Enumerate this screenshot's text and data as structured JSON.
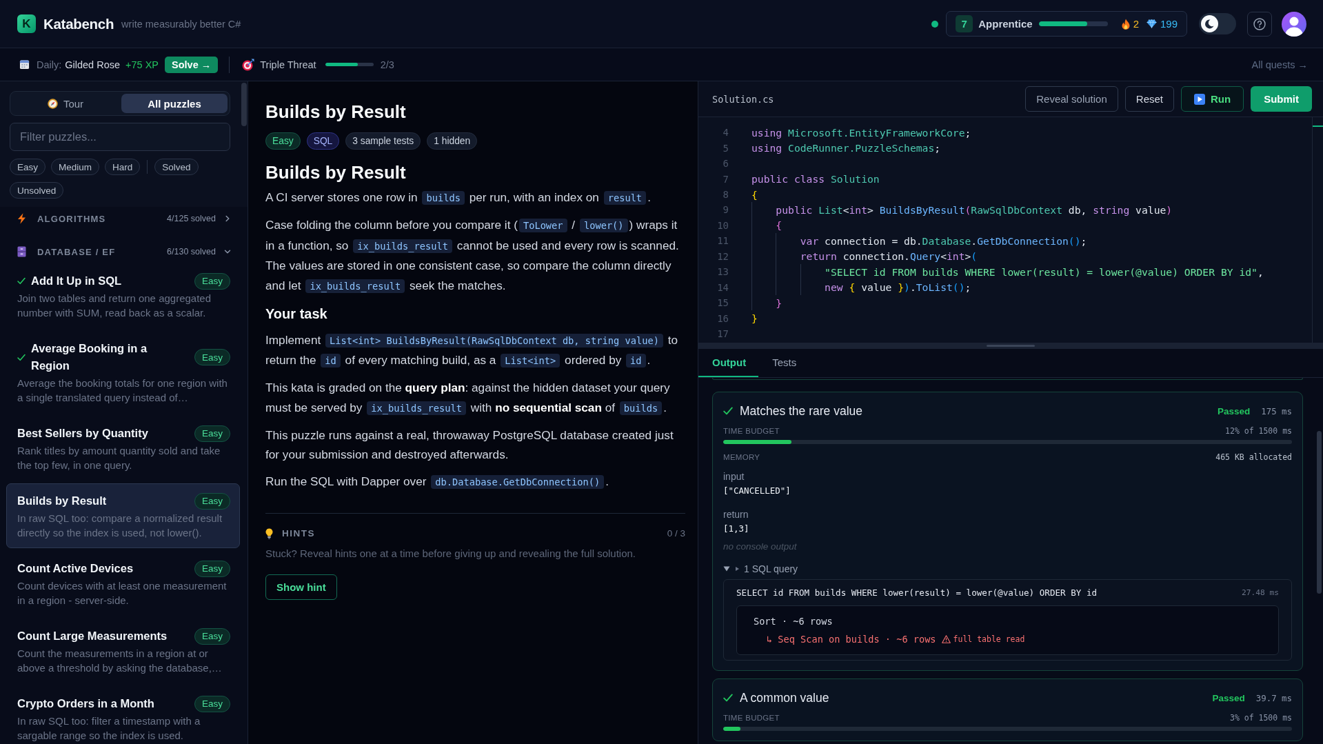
{
  "header": {
    "logo_letter": "K",
    "name": "Katabench",
    "tagline": "write measurably better C#",
    "online": true,
    "rank": {
      "badge": "7",
      "title": "Apprentice",
      "level": 0.7
    },
    "streak": "2",
    "gems": "199",
    "theme_toggle": {
      "on": false
    }
  },
  "quest_bar": {
    "daily_label": "Daily:",
    "daily_name": "Gilded Rose",
    "daily_xp": "+75 XP",
    "solve_button": "Solve →",
    "quest": {
      "name": "Triple Threat",
      "level": 0.67,
      "count": "2/3"
    },
    "all_quests": "All quests →"
  },
  "sidebar": {
    "tabs": [
      {
        "kind": "tour",
        "label": "Tour",
        "selected": false
      },
      {
        "kind": "list",
        "label": "All puzzles",
        "selected": true
      }
    ],
    "filter": {
      "placeholder": "Filter puzzles..."
    },
    "chip_groups": [
      [
        {
          "label": "Easy",
          "selected": false
        },
        {
          "label": "Medium",
          "selected": false
        },
        {
          "label": "Hard",
          "selected": false
        }
      ],
      [
        {
          "label": "Solved",
          "selected": false
        },
        {
          "label": "Unsolved",
          "selected": false
        }
      ]
    ],
    "categories": [
      {
        "kind": "algorithms",
        "title": "ALGORITHMS",
        "solved": "4/125 solved",
        "expanded": false
      },
      {
        "kind": "database",
        "title": "DATABASE / EF",
        "solved": "6/130 solved",
        "expanded": true,
        "children": [
          {
            "title": "Add It Up in SQL",
            "description": "Join two tables and return one aggregated number with SUM, read back as a scalar.",
            "difficulty": "Easy",
            "solved": true,
            "selected": false
          },
          {
            "title": "Average Booking in a Region",
            "description": "Average the booking totals for one region with a single translated query instead of…",
            "difficulty": "Easy",
            "solved": true,
            "selected": false
          },
          {
            "title": "Best Sellers by Quantity",
            "description": "Rank titles by amount quantity sold and take the top few, in one query.",
            "difficulty": "Easy",
            "solved": false,
            "selected": false
          },
          {
            "title": "Builds by Result",
            "description": "In raw SQL too: compare a normalized result directly so the index is used, not lower().",
            "difficulty": "Easy",
            "solved": false,
            "selected": true
          },
          {
            "title": "Count Active Devices",
            "description": "Count devices with at least one measurement in a region - server-side.",
            "difficulty": "Easy",
            "solved": false,
            "selected": false
          },
          {
            "title": "Count Large Measurements",
            "description": "Count the measurements in a region at or above a threshold by asking the database,…",
            "difficulty": "Easy",
            "solved": false,
            "selected": false
          },
          {
            "title": "Crypto Orders in a Month",
            "description": "In raw SQL too: filter a timestamp with a sargable range so the index is used.",
            "difficulty": "Easy",
            "solved": false,
            "selected": false
          }
        ]
      }
    ]
  },
  "problem": {
    "title": "Builds by Result",
    "tags": [
      {
        "kind": "difficulty",
        "label": "Easy"
      },
      {
        "kind": "language",
        "label": "SQL"
      },
      {
        "kind": "info",
        "label": "3 sample tests"
      },
      {
        "kind": "info",
        "label": "1 hidden"
      }
    ],
    "heading": "Builds by Result",
    "blocks": [
      {
        "kind": "para",
        "segments": [
          {
            "kind": "text",
            "text": "A CI server stores one row in "
          },
          {
            "kind": "code",
            "text": "builds"
          },
          {
            "kind": "text",
            "text": " per run, with an index on "
          },
          {
            "kind": "code",
            "text": "result"
          },
          {
            "kind": "text",
            "text": "."
          }
        ]
      },
      {
        "kind": "para",
        "segments": [
          {
            "kind": "text",
            "text": "Case folding the column before you compare it ("
          },
          {
            "kind": "code",
            "text": "ToLower"
          },
          {
            "kind": "text",
            "text": " / "
          },
          {
            "kind": "code",
            "text": "lower()"
          },
          {
            "kind": "text",
            "text": ") wraps it in a function, so "
          },
          {
            "kind": "code",
            "text": "ix_builds_result"
          },
          {
            "kind": "text",
            "text": " cannot be used and every row is scanned. The values are stored in one consistent case, so compare the column directly and let "
          },
          {
            "kind": "code",
            "text": "ix_builds_result"
          },
          {
            "kind": "text",
            "text": " seek the matches."
          }
        ]
      },
      {
        "kind": "heading",
        "text": "Your task"
      },
      {
        "kind": "para",
        "segments": [
          {
            "kind": "text",
            "text": "Implement "
          },
          {
            "kind": "code",
            "text": "List<int> BuildsByResult(RawSqlDbContext db, string value)"
          },
          {
            "kind": "text",
            "text": " to return the "
          },
          {
            "kind": "code",
            "text": "id"
          },
          {
            "kind": "text",
            "text": " of every matching build, as a "
          },
          {
            "kind": "code",
            "text": "List<int>"
          },
          {
            "kind": "text",
            "text": " ordered by "
          },
          {
            "kind": "code",
            "text": "id"
          },
          {
            "kind": "text",
            "text": "."
          }
        ]
      },
      {
        "kind": "para",
        "segments": [
          {
            "kind": "text",
            "text": "This kata is graded on the **query plan**: against the hidden dataset your query must be served by "
          },
          {
            "kind": "code",
            "text": "ix_builds_result"
          },
          {
            "kind": "text",
            "text": " with **no sequential scan** of "
          },
          {
            "kind": "code",
            "text": "builds"
          },
          {
            "kind": "text",
            "text": "."
          }
        ]
      },
      {
        "kind": "para",
        "segments": [
          {
            "kind": "text",
            "text": "This puzzle runs against a real, throwaway PostgreSQL database created just for your submission and destroyed afterwards."
          }
        ]
      },
      {
        "kind": "para",
        "segments": [
          {
            "kind": "text",
            "text": "Run the SQL with Dapper over "
          },
          {
            "kind": "code",
            "text": "db.Database.GetDbConnection()"
          },
          {
            "kind": "text",
            "text": "."
          }
        ]
      }
    ],
    "hints": {
      "title": "HINTS",
      "count": "0 / 3",
      "text": "Stuck? Reveal hints one at a time before giving up and revealing the full solution.",
      "button": "Show hint"
    }
  },
  "editor": {
    "file": "Solution.cs",
    "buttons": [
      {
        "kind": "reveal",
        "label": "Reveal solution"
      },
      {
        "kind": "reset",
        "label": "Reset"
      },
      {
        "kind": "run",
        "label": "Run"
      },
      {
        "kind": "submit",
        "label": "Submit"
      }
    ],
    "lines": [
      {
        "number": "4",
        "tokens": [
          {
            "kind": "kw",
            "text": "using"
          },
          {
            "kind": "type",
            "text": " Microsoft.EntityFrameworkCore"
          },
          {
            "kind": "plain",
            "text": ";"
          }
        ]
      },
      {
        "number": "5",
        "tokens": [
          {
            "kind": "kw",
            "text": "using"
          },
          {
            "kind": "type",
            "text": " CodeRunner.PuzzleSchemas"
          },
          {
            "kind": "plain",
            "text": ";"
          }
        ]
      },
      {
        "number": "6"
      },
      {
        "number": "7",
        "tokens": [
          {
            "kind": "kw",
            "text": "public class"
          },
          {
            "kind": "type",
            "text": " Solution"
          }
        ]
      },
      {
        "number": "8",
        "tokens": [
          {
            "kind": "b1",
            "text": "{"
          }
        ]
      },
      {
        "number": "9",
        "tokens": [
          {
            "kind": "kw",
            "text": "    public"
          },
          {
            "kind": "type",
            "text": " List"
          },
          {
            "kind": "plain",
            "text": "<"
          },
          {
            "kind": "kw",
            "text": "int"
          },
          {
            "kind": "plain",
            "text": "> "
          },
          {
            "kind": "fn",
            "text": "BuildsByResult"
          },
          {
            "kind": "b2",
            "text": "("
          },
          {
            "kind": "type",
            "text": "RawSqlDbContext"
          },
          {
            "kind": "plain",
            "text": " db, "
          },
          {
            "kind": "kw",
            "text": "string"
          },
          {
            "kind": "plain",
            "text": " value"
          },
          {
            "kind": "b2",
            "text": ")"
          }
        ]
      },
      {
        "number": "10",
        "tokens": [
          {
            "kind": "b2",
            "text": "    {"
          }
        ]
      },
      {
        "number": "11",
        "tokens": [
          {
            "kind": "kw",
            "text": "        var"
          },
          {
            "kind": "plain",
            "text": " connection = db."
          },
          {
            "kind": "type",
            "text": "Database"
          },
          {
            "kind": "plain",
            "text": "."
          },
          {
            "kind": "fn",
            "text": "GetDbConnection"
          },
          {
            "kind": "b3",
            "text": "()"
          },
          {
            "kind": "plain",
            "text": ";"
          }
        ]
      },
      {
        "number": "12",
        "tokens": [
          {
            "kind": "kw",
            "text": "        return"
          },
          {
            "kind": "plain",
            "text": " connection."
          },
          {
            "kind": "fn",
            "text": "Query"
          },
          {
            "kind": "plain",
            "text": "<"
          },
          {
            "kind": "kw",
            "text": "int"
          },
          {
            "kind": "plain",
            "text": ">"
          },
          {
            "kind": "b3",
            "text": "("
          }
        ]
      },
      {
        "number": "13",
        "tokens": [
          {
            "kind": "str",
            "text": "            \"SELECT id FROM builds WHERE lower(result) = lower(@value) ORDER BY id\""
          },
          {
            "kind": "plain",
            "text": ","
          }
        ]
      },
      {
        "number": "14",
        "tokens": [
          {
            "kind": "kw",
            "text": "            new"
          },
          {
            "kind": "b1",
            "text": " {"
          },
          {
            "kind": "plain",
            "text": " value "
          },
          {
            "kind": "b1",
            "text": "}"
          },
          {
            "kind": "b3",
            "text": ")"
          },
          {
            "kind": "plain",
            "text": "."
          },
          {
            "kind": "fn",
            "text": "ToList"
          },
          {
            "kind": "b3",
            "text": "()"
          },
          {
            "kind": "plain",
            "text": ";"
          }
        ]
      },
      {
        "number": "15",
        "tokens": [
          {
            "kind": "b2",
            "text": "    }"
          }
        ]
      },
      {
        "number": "16",
        "tokens": [
          {
            "kind": "b1",
            "text": "}"
          }
        ]
      },
      {
        "number": "17"
      }
    ]
  },
  "results": {
    "tabs": [
      {
        "label": "Output",
        "selected": true
      },
      {
        "label": "Tests",
        "selected": false
      }
    ],
    "tests": [
      {
        "name": "Matches the rare value",
        "passed": true,
        "status": "Passed",
        "duration": "175 ms",
        "budget": {
          "label": "TIME BUDGET",
          "value": "12% of 1500 ms",
          "level": 0.12
        },
        "memory": {
          "label": "MEMORY",
          "value": "465 KB allocated"
        },
        "input": {
          "label": "input",
          "value": "[\"CANCELLED\"]"
        },
        "return": {
          "label": "return",
          "value": "[1,3]"
        },
        "console": "no console output",
        "sql": {
          "expanded": true,
          "label": "1 SQL query",
          "queries": [
            {
              "text": "SELECT id FROM builds WHERE lower(result) = lower(@value) ORDER BY id",
              "duration": "27.48 ms",
              "plan": [
                {
                  "text": "Sort · ~6 rows",
                  "children": [
                    {
                      "text": "↳ Seq Scan on builds · ~6 rows",
                      "warning": "full table read"
                    }
                  ]
                }
              ]
            }
          ]
        }
      },
      {
        "name": "A common value",
        "passed": true,
        "status": "Passed",
        "duration": "39.7 ms",
        "budget": {
          "label": "TIME BUDGET",
          "value": "3% of 1500 ms",
          "level": 0.03
        }
      }
    ]
  }
}
